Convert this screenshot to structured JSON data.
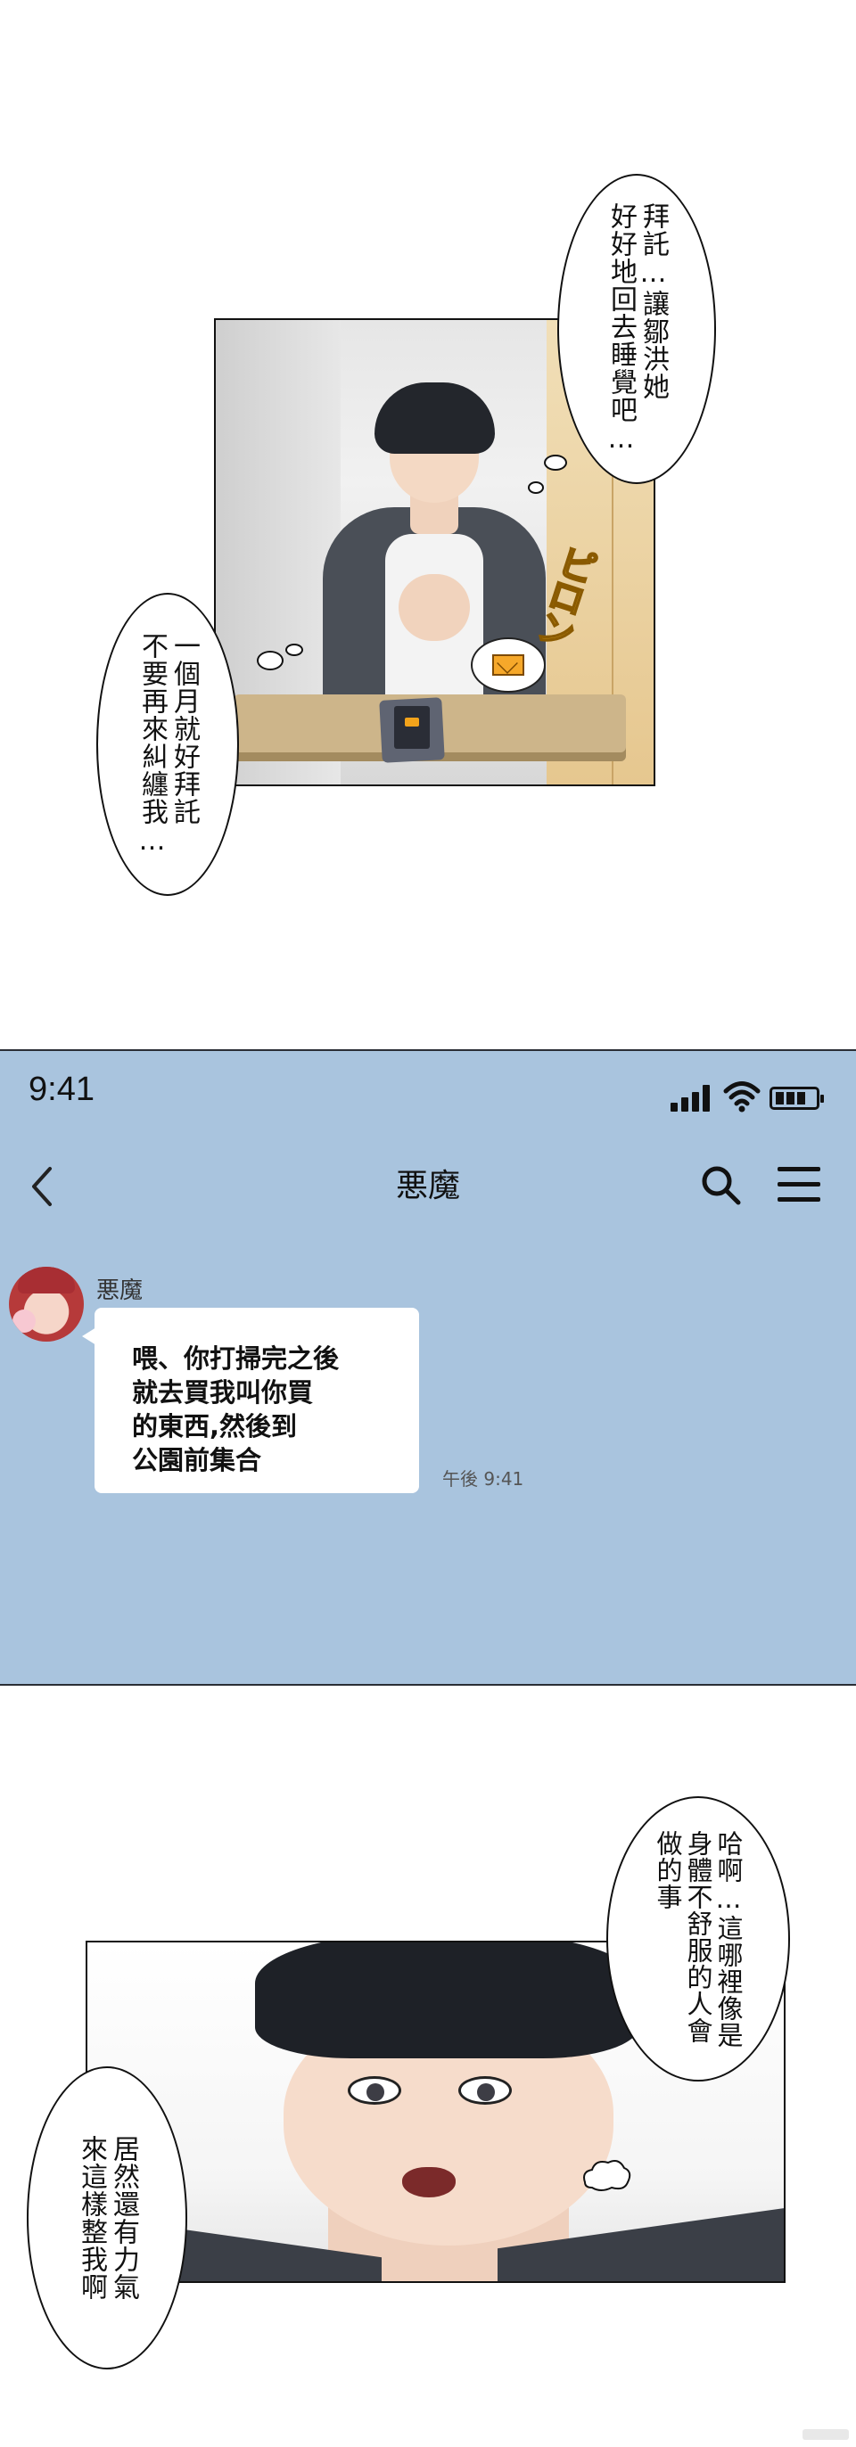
{
  "top_panel": {
    "bubble_right": "拜託…讓\n好好地\n回去睡\n覺吧…",
    "bubble_right_cols": [
      "拜託…讓鄒洪她",
      "好好地回去睡覺吧…"
    ],
    "bubble_left_cols": [
      "一個月就好拜託",
      "不要再來糾纏我…"
    ],
    "sfx": "ピロン",
    "mail_icon": "envelope-icon"
  },
  "chat": {
    "status_time": "9:41",
    "status_icons": [
      "signal-icon",
      "wifi-icon",
      "battery-icon"
    ],
    "back_icon": "chevron-left-icon",
    "title": "悪魔",
    "search_icon": "search-icon",
    "menu_icon": "hamburger-menu-icon",
    "background_color": "#a9c4de",
    "message": {
      "sender": "悪魔",
      "text": "喂、你打掃完之後\n就去買我叫你買\n的東西,然後到\n公園前集合",
      "time": "午後 9:41"
    }
  },
  "bottom_panel": {
    "bubble_right_cols": [
      "哈啊…這哪裡像是",
      "身體不舒服的人會",
      "做的事"
    ],
    "bubble_left_cols": [
      "居然還有力氣",
      "來這樣整我啊"
    ]
  }
}
